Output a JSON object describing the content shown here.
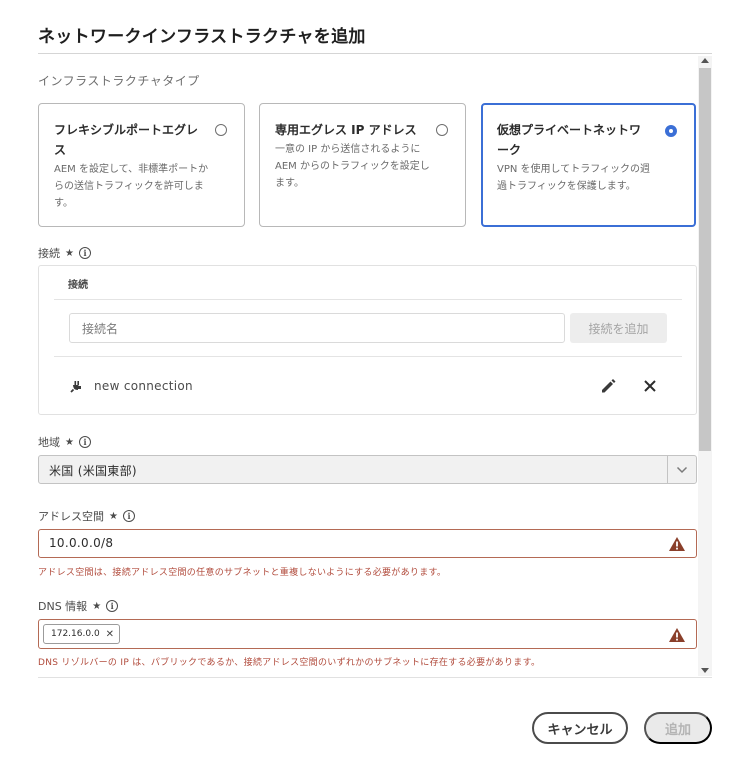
{
  "dialog": {
    "title": "ネットワークインフラストラクチャを追加"
  },
  "infra_type": {
    "section_label": "インフラストラクチャタイプ",
    "cards": [
      {
        "title": "フレキシブルポートエグレス",
        "description": "AEM を設定して、非標準ポートからの送信トラフィックを許可します。",
        "selected": false
      },
      {
        "title": "専用エグレス IP アドレス",
        "description": "一意の IP から送信されるようにAEM からのトラフィックを設定します。",
        "selected": false
      },
      {
        "title": "仮想プライベートネットワーク",
        "description": "VPN を使用してトラフィックの週過トラフィックを保護します。",
        "selected": true
      }
    ]
  },
  "connections": {
    "label": "接続",
    "required": "★",
    "panel_heading": "接続",
    "input_placeholder": "接続名",
    "add_button_label": "接続を追加",
    "items": [
      {
        "name": "new connection"
      }
    ]
  },
  "region": {
    "label": "地域",
    "required": "★",
    "value": "米国 (米国東部)"
  },
  "address_space": {
    "label": "アドレス空間",
    "required": "★",
    "value": "10.0.0.0/8",
    "error": "アドレス空間は、接続アドレス空間の任意のサブネットと重複しないようにする必要があります。"
  },
  "dns": {
    "label": "DNS 情報",
    "required": "★",
    "tags": [
      "172.16.0.0"
    ],
    "error": "DNS リゾルバーの IP は、パブリックであるか、接続アドレス空間のいずれかのサブネットに存在する必要があります。"
  },
  "footer": {
    "cancel_label": "キャンセル",
    "add_label": "追加"
  },
  "colors": {
    "accent": "#3b6fd6",
    "error": "#b14b3c",
    "warning_icon": "#8a3f2a"
  },
  "icons": [
    "info-icon",
    "plug-icon",
    "pencil-icon",
    "close-icon",
    "chevron-down-icon",
    "warning-icon"
  ]
}
